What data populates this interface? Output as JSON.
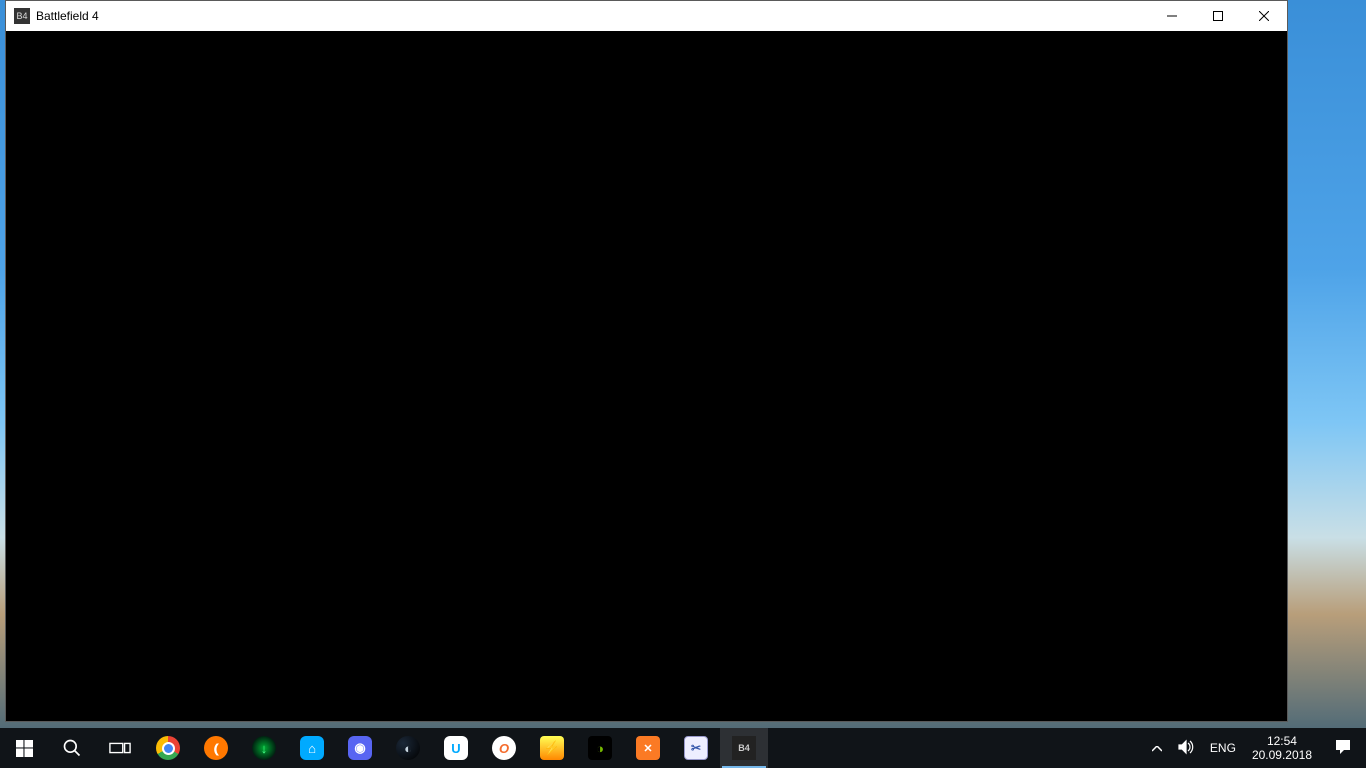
{
  "window": {
    "title": "Battlefield 4",
    "icon_name": "battlefield4-icon"
  },
  "taskbar": {
    "items": [
      {
        "name": "start-button",
        "label": "Start"
      },
      {
        "name": "search-button",
        "label": "Search"
      },
      {
        "name": "task-view-button",
        "label": "Task View"
      },
      {
        "name": "chrome-icon",
        "label": "Google Chrome"
      },
      {
        "name": "avast-icon",
        "label": "Avast"
      },
      {
        "name": "vortex-icon",
        "label": "Vortex"
      },
      {
        "name": "uplaypc-icon",
        "label": "Uplay PC"
      },
      {
        "name": "discord-icon",
        "label": "Discord"
      },
      {
        "name": "steam-icon",
        "label": "Steam"
      },
      {
        "name": "uplay-icon",
        "label": "Uplay"
      },
      {
        "name": "origin-icon",
        "label": "Origin"
      },
      {
        "name": "daemon-tools-icon",
        "label": "DAEMON Tools"
      },
      {
        "name": "nvidia-icon",
        "label": "NVIDIA GeForce Experience"
      },
      {
        "name": "xampp-icon",
        "label": "XAMPP"
      },
      {
        "name": "snipping-tool-icon",
        "label": "Snipping Tool"
      },
      {
        "name": "battlefield4-task-icon",
        "label": "Battlefield 4"
      }
    ],
    "tray": {
      "language": "ENG",
      "time": "12:54",
      "date": "20.09.2018"
    }
  }
}
